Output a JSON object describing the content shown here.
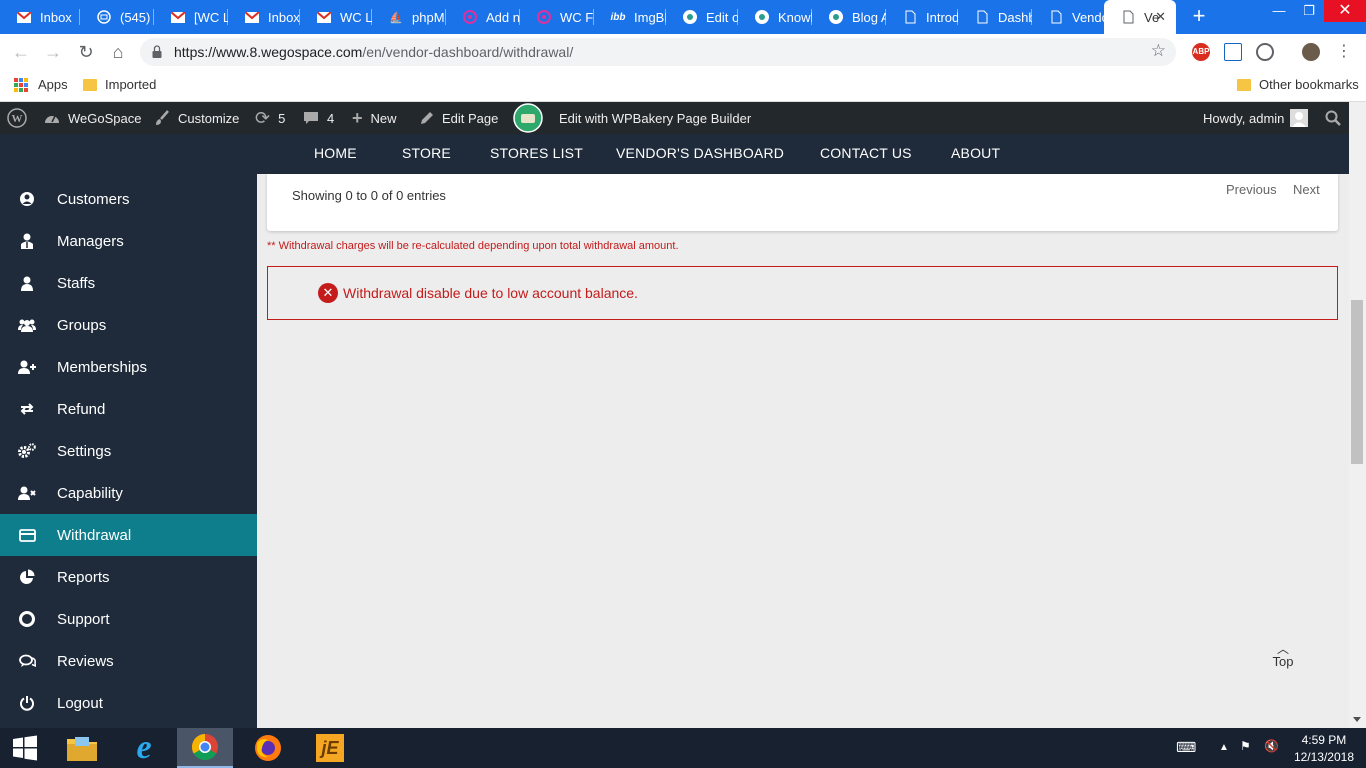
{
  "browser": {
    "tabs": [
      {
        "title": "Inbox",
        "favicon": "gmail-icon"
      },
      {
        "title": "(545)",
        "favicon": "mail-icon"
      },
      {
        "title": "[WC L",
        "favicon": "gmail-icon"
      },
      {
        "title": "Inbox",
        "favicon": "gmail-icon"
      },
      {
        "title": "WC Lo",
        "favicon": "gmail-icon"
      },
      {
        "title": "phpM",
        "favicon": "phpmyadmin-icon"
      },
      {
        "title": "Add n",
        "favicon": "plugin-icon"
      },
      {
        "title": "WC Fr",
        "favicon": "plugin-icon"
      },
      {
        "title": "ImgBB",
        "favicon": "imgbb-icon"
      },
      {
        "title": "Edit o",
        "favicon": "site-icon"
      },
      {
        "title": "Knowl",
        "favicon": "site-icon"
      },
      {
        "title": "Blog A",
        "favicon": "site-icon"
      },
      {
        "title": "Introd",
        "favicon": "page-icon"
      },
      {
        "title": "Dashb",
        "favicon": "page-icon"
      },
      {
        "title": "Vendo",
        "favicon": "page-icon"
      },
      {
        "title": "Ve",
        "favicon": "page-icon",
        "active": true
      }
    ],
    "url_host": "https://www.8.wegospace.com",
    "url_path": "/en/vendor-dashboard/withdrawal/",
    "new_tab_symbol": "+",
    "extensions": [
      "ABP"
    ]
  },
  "bookmarks": {
    "apps_label": "Apps",
    "imported_label": "Imported",
    "other_label": "Other bookmarks"
  },
  "adminbar": {
    "site_name": "WeGoSpace",
    "customize": "Customize",
    "updates_count": "5",
    "comments_count": "4",
    "new_label": "New",
    "edit_page": "Edit Page",
    "wpbakery": "Edit with WPBakery Page Builder",
    "howdy": "Howdy, admin"
  },
  "sitenav": {
    "items": [
      "HOME",
      "STORE",
      "STORES LIST",
      "VENDOR'S DASHBOARD",
      "CONTACT US",
      "ABOUT"
    ]
  },
  "sidebar": {
    "items": [
      {
        "label": "Customers",
        "icon": "user-circle-icon"
      },
      {
        "label": "Managers",
        "icon": "manager-icon"
      },
      {
        "label": "Staffs",
        "icon": "user-icon"
      },
      {
        "label": "Groups",
        "icon": "users-icon"
      },
      {
        "label": "Memberships",
        "icon": "user-plus-icon"
      },
      {
        "label": "Refund",
        "icon": "refund-icon"
      },
      {
        "label": "Settings",
        "icon": "cogs-icon"
      },
      {
        "label": "Capability",
        "icon": "user-times-icon"
      },
      {
        "label": "Withdrawal",
        "icon": "credit-card-icon",
        "active": true
      },
      {
        "label": "Reports",
        "icon": "pie-chart-icon"
      },
      {
        "label": "Support",
        "icon": "life-ring-icon"
      },
      {
        "label": "Reviews",
        "icon": "comments-icon"
      },
      {
        "label": "Logout",
        "icon": "power-icon"
      }
    ]
  },
  "main": {
    "entries_info": "Showing 0 to 0 of 0 entries",
    "previous": "Previous",
    "next": "Next",
    "charges_note": "** Withdrawal charges will be re-calculated depending upon total withdrawal amount.",
    "alert_message": "Withdrawal disable due to low account balance.",
    "top_label": "Top",
    "error_color": "#c41b1b",
    "active_color": "#0f7e8c"
  },
  "taskbar": {
    "time": "4:59 PM",
    "date": "12/13/2018"
  }
}
